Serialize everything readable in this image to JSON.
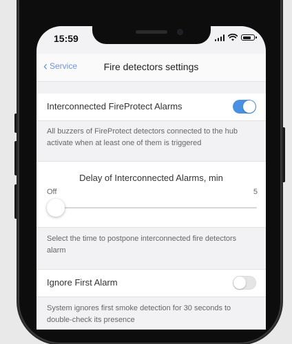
{
  "status_bar": {
    "time": "15:59"
  },
  "nav": {
    "back_label": "Service",
    "title": "Fire detectors settings"
  },
  "interconnected": {
    "label": "Interconnected FireProtect Alarms",
    "enabled": true,
    "description": "All buzzers of FireProtect detectors connected to the hub activate when at least one of them is triggered"
  },
  "delay": {
    "title": "Delay of Interconnected Alarms, min",
    "min_label": "Off",
    "max_label": "5",
    "value_fraction": 0,
    "description": "Select the time to postpone interconnected fire detectors alarm"
  },
  "ignore_first": {
    "label": "Ignore First Alarm",
    "enabled": false,
    "description": "System ignores first smoke detection for 30 seconds to double-check its presence"
  },
  "colors": {
    "accent": "#4a90e2",
    "back_link": "#6c93d6",
    "toggle_off": "#e5e5e5"
  },
  "icons": {
    "back": "chevron-left-icon",
    "signal": "signal-icon",
    "wifi": "wifi-icon",
    "battery": "battery-icon"
  }
}
